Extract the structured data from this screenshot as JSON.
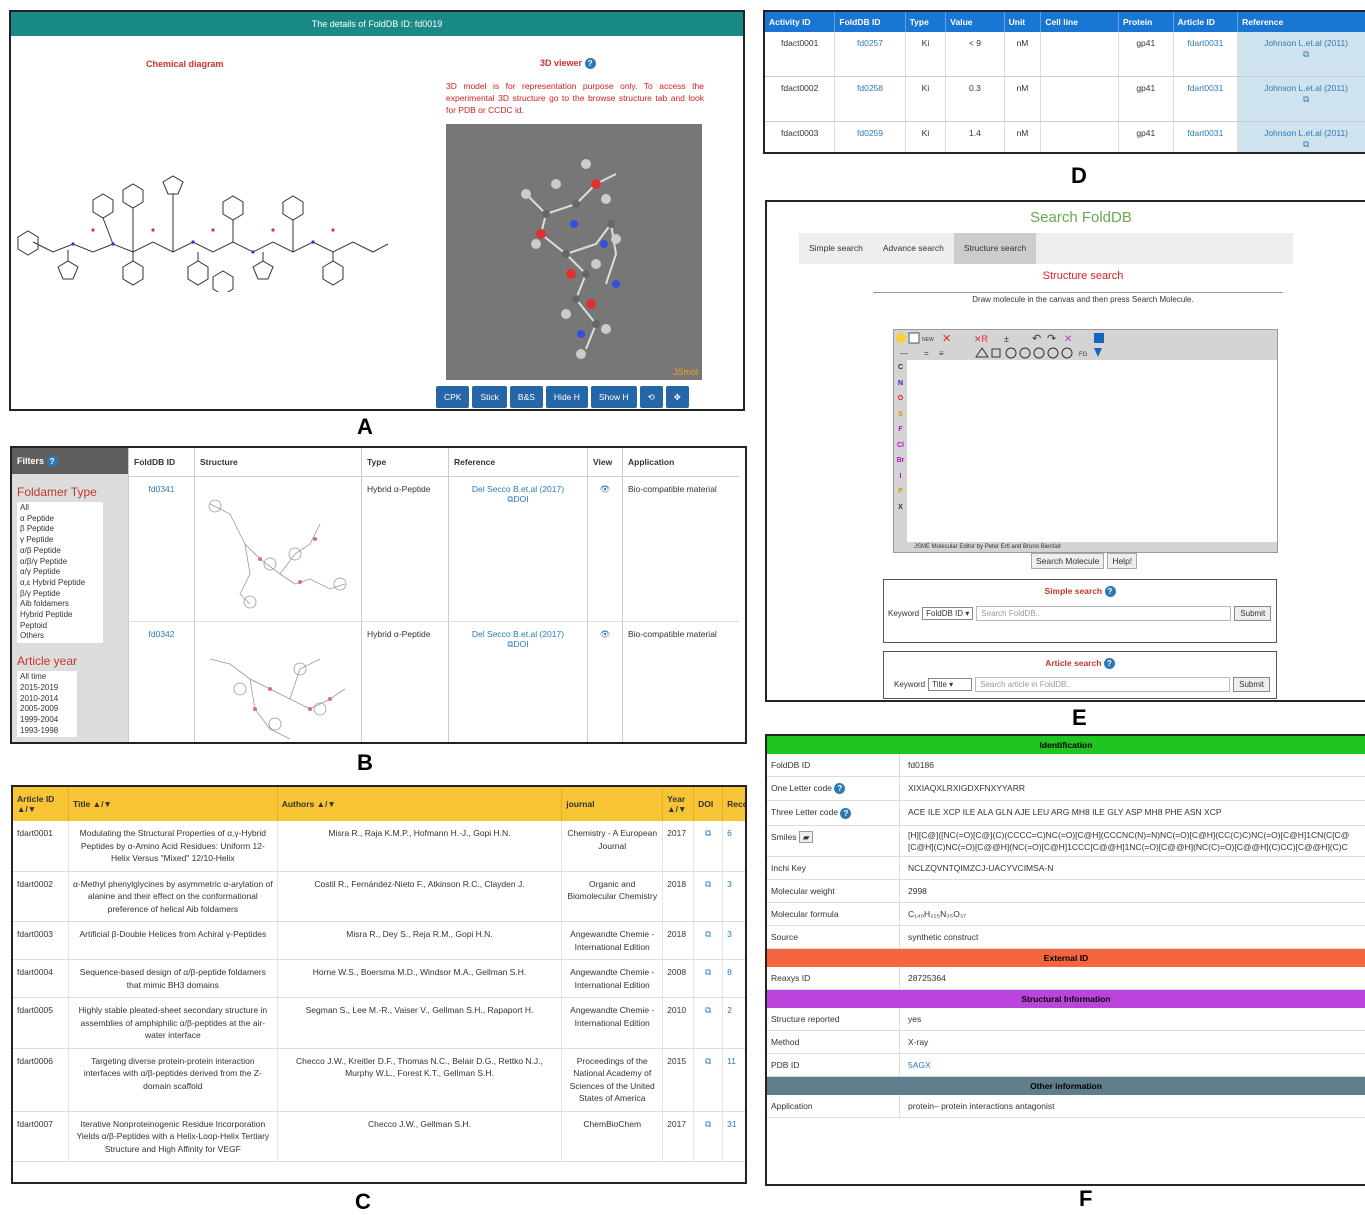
{
  "panel_labels": {
    "a": "A",
    "b": "B",
    "c": "C",
    "d": "D",
    "e": "E",
    "f": "F"
  },
  "panel_a": {
    "header": "The details of FoldDB ID: fd0019",
    "chem_title": "Chemical diagram",
    "viewer_title": "3D viewer",
    "viewer_note": "3D model is for representation purpose only. To access the experimental 3D structure go to the browse structure tab and look for PDB or CCDC id.",
    "jsmol": "JSmol",
    "buttons": [
      "CPK",
      "Stick",
      "B&S",
      "Hide H",
      "Show H"
    ]
  },
  "panel_b": {
    "filters_label": "Filters",
    "foldamer_title": "Foldamer Type",
    "foldamer_options": [
      "All",
      "α Peptide",
      "β Peptide",
      "γ Peptide",
      "α/β Peptide",
      "α/β/γ Peptide",
      "α/γ Peptide",
      "α,ε Hybrid Peptide",
      "β/γ Peptide",
      "Aib foldamers",
      "Hybrid Peptide",
      "Peptoid",
      "Others"
    ],
    "year_title": "Article year",
    "year_options": [
      "All time",
      "2015-2019",
      "2010-2014",
      "2005-2009",
      "1999-2004",
      "1993-1998"
    ],
    "columns": [
      "FoldDB ID",
      "Structure",
      "Type",
      "Reference",
      "View",
      "Application"
    ],
    "rows": [
      {
        "id": "fd0341",
        "type": "Hybrid α-Peptide",
        "ref": "Del Secco B.et.al (2017)",
        "doi": "DOI",
        "app": "Bio-compatible material"
      },
      {
        "id": "fd0342",
        "type": "Hybrid α-Peptide",
        "ref": "Del Secco B.et.al (2017)",
        "doi": "DOI",
        "app": "Bio-compatible material"
      }
    ]
  },
  "panel_c": {
    "columns": [
      "Article ID ▲/▼",
      "Title ▲/▼",
      "Authors ▲/▼",
      "journal",
      "Year ▲/▼",
      "DOI",
      "Reco"
    ],
    "rows": [
      {
        "id": "fdart0001",
        "title": "Modulating the Structural Properties of α,γ-Hybrid Peptides by α-Amino Acid Residues: Uniform 12-Helix Versus \"Mixed\" 12/10-Helix",
        "authors": "Misra R., Raja K.M.P., Hofmann H.-J., Gopi H.N.",
        "journal": "Chemistry - A European Journal",
        "year": "2017",
        "rec": "6"
      },
      {
        "id": "fdart0002",
        "title": "α-Methyl phenylglycines by asymmetric α-arylation of alanine and their effect on the conformational preference of helical Aib foldamers",
        "authors": "Costil R., Fernández-Nieto F., Atkinson R.C., Clayden J.",
        "journal": "Organic and Biomolecular Chemistry",
        "year": "2018",
        "rec": "3"
      },
      {
        "id": "fdart0003",
        "title": "Artificial β-Double Helices from Achiral γ-Peptides",
        "authors": "Misra R., Dey S., Reja R.M., Gopi H.N.",
        "journal": "Angewandte Chemie - International Edition",
        "year": "2018",
        "rec": "3"
      },
      {
        "id": "fdart0004",
        "title": "Sequence-based design of α/β-peptide foldamers that mimic BH3 domains",
        "authors": "Horne W.S., Boersma M.D., Windsor M.A., Gellman S.H.",
        "journal": "Angewandte Chemie - International Edition",
        "year": "2008",
        "rec": "8"
      },
      {
        "id": "fdart0005",
        "title": "Highly stable pleated-sheet secondary structure in assemblies of amphiphilic α/β-peptides at the air-water interface",
        "authors": "Segman S., Lee M.-R., Vaiser V., Gellman S.H., Rapaport H.",
        "journal": "Angewandte Chemie - International Edition",
        "year": "2010",
        "rec": "2"
      },
      {
        "id": "fdart0006",
        "title": "Targeting diverse protein-protein interaction interfaces with α/β-peptides derived from the Z-domain scaffold",
        "authors": "Checco J.W., Kreitler D.F., Thomas N.C., Belair D.G., Rettko N.J., Murphy W.L., Forest K.T., Gellman S.H.",
        "journal": "Proceedings of the National Academy of Sciences of the United States of America",
        "year": "2015",
        "rec": "11"
      },
      {
        "id": "fdart0007",
        "title": "Iterative Nonproteinogenic Residue Incorporation Yields α/β-Peptides with a Helix-Loop-Helix Tertiary Structure and High Affinity for VEGF",
        "authors": "Checco J.W., Gellman S.H.",
        "journal": "ChemBioChem",
        "year": "2017",
        "rec": "31"
      }
    ]
  },
  "panel_d": {
    "columns": [
      "Activity ID",
      "FoldDB ID",
      "Type",
      "Value",
      "Unit",
      "Cell line",
      "Protein",
      "Article ID",
      "Reference"
    ],
    "rows": [
      {
        "act": "fdact0001",
        "fd": "fd0257",
        "type": "Ki",
        "value": "< 9",
        "unit": "nM",
        "cell": "",
        "protein": "gp41",
        "art": "fdart0031",
        "ref": "Johnson L.et.al (2011)"
      },
      {
        "act": "fdact0002",
        "fd": "fd0258",
        "type": "Ki",
        "value": "0.3",
        "unit": "nM",
        "cell": "",
        "protein": "gp41",
        "art": "fdart0031",
        "ref": "Johnson L.et.al (2011)"
      },
      {
        "act": "fdact0003",
        "fd": "fd0259",
        "type": "Ki",
        "value": "1.4",
        "unit": "nM",
        "cell": "",
        "protein": "gp41",
        "art": "fdart0031",
        "ref": "Johnson L.et.al (2011)"
      }
    ]
  },
  "panel_e": {
    "title": "Search FoldDB",
    "tabs": [
      "Simple search",
      "Advance search",
      "Structure search"
    ],
    "subtitle": "Structure search",
    "instruction": "Draw molecule in the canvas and then press Search Molecule.",
    "editor_new": "NEW",
    "editor_fg": "FG",
    "elements": [
      "C",
      "N",
      "O",
      "S",
      "F",
      "Cl",
      "Br",
      "I",
      "P",
      "X"
    ],
    "editor_footer": "JSME Molecular Editor by Peter Ertl and Bruno Bienfait",
    "search_molecule": "Search Molecule",
    "help": "Help!",
    "simple_title": "Simple search",
    "keyword": "Keyword",
    "simple_select": "FoldDB ID",
    "simple_placeholder": "Search FoldDB..",
    "submit": "Submit",
    "article_title": "Article search",
    "article_select": "Title",
    "article_placeholder": "Search article in FoldDB.."
  },
  "panel_f": {
    "sections": [
      {
        "title": "Identification",
        "color": "#21c521",
        "rows": [
          {
            "k": "FoldDB ID",
            "v": "fd0186"
          },
          {
            "k": "One Letter code",
            "v": "XIXIAQXLRXIGDXFNXYYARR",
            "help": true
          },
          {
            "k": "Three Letter code",
            "v": "ACE ILE XCP ILE ALA GLN AJE LEU ARG MH8 ILE GLY ASP MH8 PHE ASN XCP",
            "help": true
          },
          {
            "k": "Smiles",
            "v": "[H][C@]([NC(=O)[C@](C)(CCCC=C)NC(=O)[C@H](CCCNC(N)=N)NC(=O)[C@H](CC(C)C)NC(=O)[C@H]1CN(C[C@",
            "v2": "[C@H](C)NC(=O)[C@@H](NC(=O)[C@H]1CCC[C@@H]1NC(=O)[C@@H](NC(C)=O)[C@@H](C)CC)[C@@H](C)C",
            "smiles": true
          },
          {
            "k": "Inchi Key",
            "v": "NCLZQVNTQIMZCJ-UACYVCIMSA-N"
          },
          {
            "k": "Molecular weight",
            "v": "2998"
          },
          {
            "k": "Molecular formula",
            "v": "C₁₄₀H₂₂₅N₃₅O₃₇"
          },
          {
            "k": "Source",
            "v": "synthetic construct"
          }
        ]
      },
      {
        "title": "External ID",
        "color": "#f4663f",
        "rows": [
          {
            "k": "Reaxys ID",
            "v": "28725364"
          }
        ]
      },
      {
        "title": "Structural Information",
        "color": "#bb44dd",
        "rows": [
          {
            "k": "Structure reported",
            "v": "yes"
          },
          {
            "k": "Method",
            "v": "X-ray"
          },
          {
            "k": "PDB ID",
            "v": "5AGX",
            "link": true
          }
        ]
      },
      {
        "title": "Other information",
        "color": "#607d8b",
        "rows": [
          {
            "k": "Application",
            "v": "protein– protein interactions antagonist"
          }
        ]
      }
    ]
  }
}
